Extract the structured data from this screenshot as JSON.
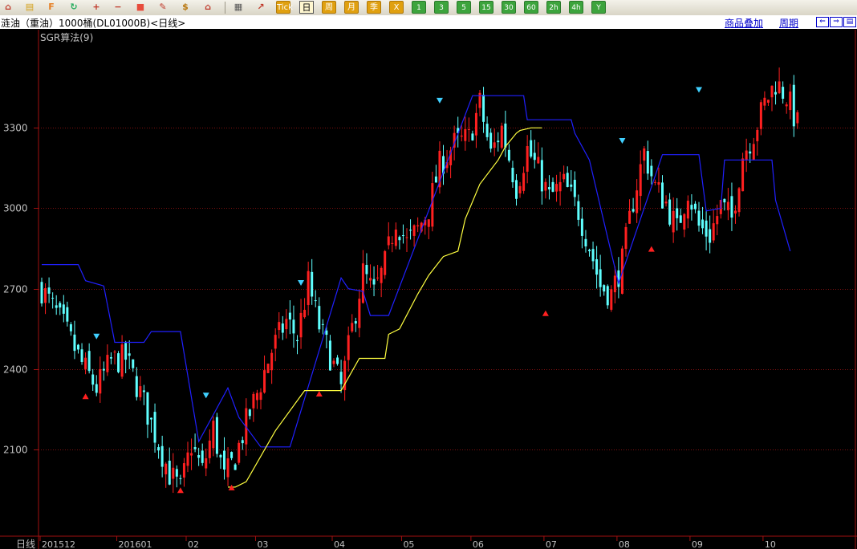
{
  "toolbar": {
    "buttons": [
      {
        "id": "home-icon",
        "kind": "icon",
        "color": "#c0392b",
        "glyph": "⌂"
      },
      {
        "id": "database-icon",
        "kind": "icon",
        "color": "#d4a017",
        "glyph": "▤"
      },
      {
        "id": "futures-icon",
        "kind": "icon",
        "color": "#e67e22",
        "glyph": "F"
      },
      {
        "id": "refresh-icon",
        "kind": "icon",
        "color": "#27ae60",
        "glyph": "↻"
      },
      {
        "id": "zoom-in-icon",
        "kind": "icon",
        "color": "#c0392b",
        "glyph": "+"
      },
      {
        "id": "zoom-out-icon",
        "kind": "icon",
        "color": "#c0392b",
        "glyph": "−"
      },
      {
        "id": "window-icon",
        "kind": "icon",
        "color": "#e74c3c",
        "glyph": "■"
      },
      {
        "id": "pencil-icon",
        "kind": "icon",
        "color": "#c0392b",
        "glyph": "✎"
      },
      {
        "id": "money-bag-icon",
        "kind": "icon",
        "color": "#b9770e",
        "glyph": "$"
      },
      {
        "id": "shop-icon",
        "kind": "icon",
        "color": "#c0392b",
        "glyph": "⌂"
      },
      {
        "id": "table-icon",
        "kind": "icon",
        "color": "#555555",
        "glyph": "▦"
      },
      {
        "id": "trend-icon",
        "kind": "icon",
        "color": "#c0392b",
        "glyph": "↗"
      },
      {
        "id": "tick-button",
        "kind": "text",
        "label": "Tick"
      },
      {
        "id": "period-day-button",
        "kind": "active",
        "label": "日"
      },
      {
        "id": "period-week-button",
        "kind": "text",
        "label": "周"
      },
      {
        "id": "period-month-button",
        "kind": "text",
        "label": "月"
      },
      {
        "id": "period-season-button",
        "kind": "text",
        "label": "季"
      },
      {
        "id": "period-year-button",
        "kind": "text",
        "label": "X"
      },
      {
        "id": "period-1m-button",
        "kind": "num",
        "label": "1"
      },
      {
        "id": "period-3m-button",
        "kind": "num",
        "label": "3"
      },
      {
        "id": "period-5m-button",
        "kind": "num",
        "label": "5"
      },
      {
        "id": "period-15m-button",
        "kind": "num",
        "label": "15"
      },
      {
        "id": "period-30m-button",
        "kind": "num",
        "label": "30"
      },
      {
        "id": "period-60m-button",
        "kind": "num",
        "label": "60"
      },
      {
        "id": "period-2h-button",
        "kind": "num",
        "label": "2h"
      },
      {
        "id": "period-4h-button",
        "kind": "num",
        "label": "4h"
      },
      {
        "id": "period-y-button",
        "kind": "num",
        "label": "Y"
      }
    ]
  },
  "header": {
    "title": "涟油（重油）1000桶(DL01000B)<日线>",
    "overlay_link": "商品叠加",
    "period_link": "周期",
    "nav_left": "⇐",
    "nav_right": "⇒",
    "nav_last": "▤"
  },
  "indicator": {
    "label": "SGR算法(9)"
  },
  "colors": {
    "up": "#ff2020",
    "down": "#5fffff",
    "upper_band": "#2020ff",
    "lower_band": "#ffff40",
    "grid": "#801010",
    "axis": "#a01010",
    "axis_text": "#c0c0c0",
    "sell_marker": "#40d0ff",
    "buy_marker": "#ff2020"
  },
  "chart_data": {
    "type": "candlestick",
    "period_label": "日线",
    "y_ticks": [
      2100,
      2400,
      2700,
      3000,
      3300
    ],
    "ylim": [
      1780,
      3660
    ],
    "x_labels": [
      {
        "i": 0,
        "label": "201512"
      },
      {
        "i": 21,
        "label": "201601"
      },
      {
        "i": 40,
        "label": "02"
      },
      {
        "i": 59,
        "label": "03"
      },
      {
        "i": 80,
        "label": "04"
      },
      {
        "i": 99,
        "label": "05"
      },
      {
        "i": 118,
        "label": "06"
      },
      {
        "i": 138,
        "label": "07"
      },
      {
        "i": 158,
        "label": "08"
      },
      {
        "i": 178,
        "label": "09"
      },
      {
        "i": 198,
        "label": "10"
      }
    ],
    "close_path": [
      [
        0,
        2700
      ],
      [
        6,
        2560
      ],
      [
        11,
        2420
      ],
      [
        15,
        2330
      ],
      [
        19,
        2430
      ],
      [
        23,
        2440
      ],
      [
        27,
        2310
      ],
      [
        31,
        2160
      ],
      [
        35,
        2010
      ],
      [
        38,
        1950
      ],
      [
        41,
        2120
      ],
      [
        44,
        2020
      ],
      [
        47,
        2180
      ],
      [
        50,
        1990
      ],
      [
        53,
        2070
      ],
      [
        56,
        2200
      ],
      [
        59,
        2310
      ],
      [
        63,
        2470
      ],
      [
        67,
        2580
      ],
      [
        70,
        2520
      ],
      [
        73,
        2720
      ],
      [
        76,
        2560
      ],
      [
        79,
        2450
      ],
      [
        82,
        2330
      ],
      [
        85,
        2550
      ],
      [
        88,
        2760
      ],
      [
        91,
        2680
      ],
      [
        94,
        2790
      ],
      [
        97,
        2960
      ],
      [
        100,
        2870
      ],
      [
        103,
        2920
      ],
      [
        106,
        3000
      ],
      [
        109,
        3160
      ],
      [
        113,
        3240
      ],
      [
        117,
        3260
      ],
      [
        120,
        3390
      ],
      [
        123,
        3200
      ],
      [
        126,
        3300
      ],
      [
        130,
        3080
      ],
      [
        133,
        3220
      ],
      [
        136,
        3140
      ],
      [
        139,
        3040
      ],
      [
        143,
        3090
      ],
      [
        147,
        2990
      ],
      [
        150,
        2860
      ],
      [
        153,
        2710
      ],
      [
        156,
        2680
      ],
      [
        159,
        2800
      ],
      [
        162,
        3030
      ],
      [
        165,
        3210
      ],
      [
        168,
        3080
      ],
      [
        171,
        3020
      ],
      [
        174,
        2920
      ],
      [
        177,
        3070
      ],
      [
        180,
        2930
      ],
      [
        183,
        2900
      ],
      [
        186,
        3010
      ],
      [
        189,
        2960
      ],
      [
        192,
        3200
      ],
      [
        195,
        3280
      ],
      [
        198,
        3390
      ],
      [
        201,
        3470
      ],
      [
        204,
        3420
      ],
      [
        207,
        3310
      ]
    ],
    "upper_band": [
      [
        0,
        2790
      ],
      [
        10,
        2790
      ],
      [
        12,
        2730
      ],
      [
        17,
        2710
      ],
      [
        20,
        2500
      ],
      [
        28,
        2500
      ],
      [
        30,
        2540
      ],
      [
        38,
        2540
      ],
      [
        43,
        2130
      ],
      [
        51,
        2330
      ],
      [
        54,
        2220
      ],
      [
        60,
        2110
      ],
      [
        68,
        2110
      ],
      [
        82,
        2740
      ],
      [
        84,
        2700
      ],
      [
        88,
        2690
      ],
      [
        90,
        2600
      ],
      [
        95,
        2600
      ],
      [
        118,
        3420
      ],
      [
        132,
        3420
      ],
      [
        133,
        3330
      ],
      [
        145,
        3330
      ],
      [
        146,
        3280
      ],
      [
        150,
        3180
      ],
      [
        155,
        2890
      ],
      [
        158,
        2720
      ],
      [
        163,
        2920
      ],
      [
        170,
        3200
      ],
      [
        180,
        3200
      ],
      [
        182,
        2990
      ],
      [
        186,
        3000
      ],
      [
        187,
        3180
      ],
      [
        200,
        3180
      ],
      [
        201,
        3030
      ],
      [
        205,
        2840
      ]
    ],
    "lower_band": [
      [
        51,
        1960
      ],
      [
        53,
        1960
      ],
      [
        56,
        1980
      ],
      [
        64,
        2170
      ],
      [
        72,
        2320
      ],
      [
        82,
        2320
      ],
      [
        87,
        2440
      ],
      [
        94,
        2440
      ],
      [
        95,
        2530
      ],
      [
        98,
        2550
      ],
      [
        103,
        2680
      ],
      [
        106,
        2750
      ],
      [
        110,
        2820
      ],
      [
        114,
        2840
      ],
      [
        116,
        2960
      ],
      [
        120,
        3090
      ],
      [
        125,
        3180
      ],
      [
        127,
        3230
      ],
      [
        130,
        3280
      ],
      [
        131,
        3290
      ],
      [
        134,
        3300
      ],
      [
        137,
        3300
      ]
    ],
    "markers": [
      {
        "type": "sell",
        "i": 15,
        "price": 2520
      },
      {
        "type": "sell",
        "i": 45,
        "price": 2300
      },
      {
        "type": "sell",
        "i": 71,
        "price": 2720
      },
      {
        "type": "sell",
        "i": 109,
        "price": 3400
      },
      {
        "type": "sell",
        "i": 159,
        "price": 3250
      },
      {
        "type": "sell",
        "i": 180,
        "price": 3440
      },
      {
        "type": "buy",
        "i": 12,
        "price": 2300
      },
      {
        "type": "buy",
        "i": 38,
        "price": 1950
      },
      {
        "type": "buy",
        "i": 52,
        "price": 1960
      },
      {
        "type": "buy",
        "i": 76,
        "price": 2310
      },
      {
        "type": "buy",
        "i": 138,
        "price": 2610
      },
      {
        "type": "buy",
        "i": 167,
        "price": 2850
      }
    ]
  }
}
